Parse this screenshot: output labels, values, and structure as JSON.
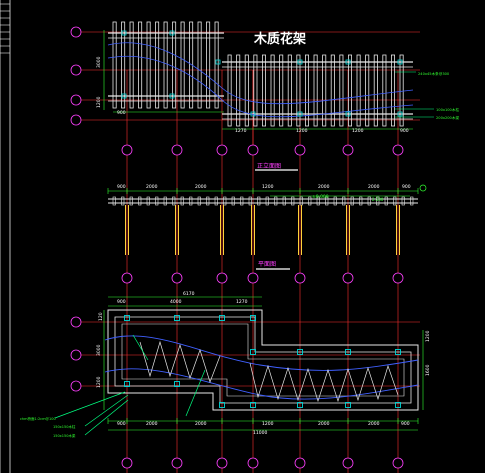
{
  "drawing": {
    "title": "木质花架",
    "colors": {
      "background": "#000000",
      "frame": "#e8e8e8",
      "axis": "#ff3030",
      "dimension": "#30ff30",
      "bubble": "#ff40ff",
      "curve": "#4060ff",
      "beam": "#ffd23a",
      "post": "#00d8d8",
      "leader": "#00ff80",
      "label_text": "#ffffff"
    },
    "plan_top": {
      "dims_bottom": [
        "900",
        "1270",
        "1200",
        "1200",
        "900"
      ],
      "dims_left": [
        "3000",
        "1200"
      ],
      "notes": [
        "240x45木条@300",
        "100x100木柱",
        "200x200木梁"
      ]
    },
    "section_label": "正立面图",
    "elevation": {
      "dims_top": [
        "900",
        "2000",
        "2000",
        "1200",
        "2000",
        "2000",
        "900"
      ],
      "level_mark": "±0.000",
      "note": "2.500"
    },
    "plan_label": "平面图",
    "plan_bottom": {
      "dims_top": [
        "900",
        "4000",
        "1270"
      ],
      "dims_top_total": "6170",
      "dims_bottom": [
        "900",
        "2000",
        "2000",
        "1200",
        "2000",
        "2000",
        "900"
      ],
      "dims_bottom_total": "11000",
      "dims_left": [
        "120",
        "3000",
        "1200"
      ],
      "dims_right": [
        "1200",
        "1600"
      ],
      "notes": [
        "chm桥面1:2cm@100",
        "150x150木柱",
        "150x150木梁"
      ]
    }
  }
}
